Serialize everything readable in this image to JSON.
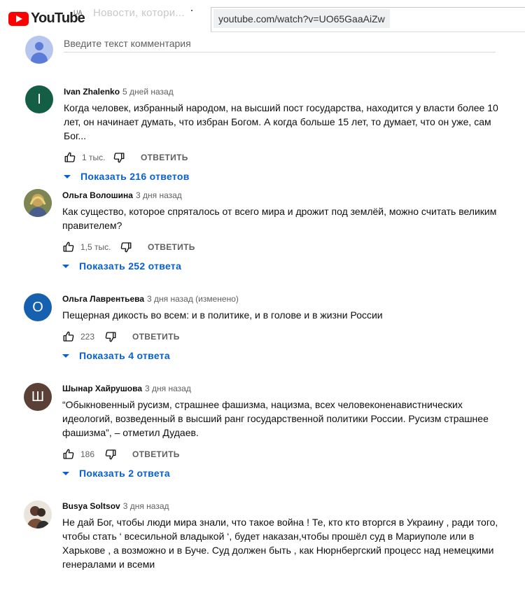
{
  "header": {
    "logo_text": "YouTube",
    "region": "UA",
    "ghost_title": "Новости, котори...",
    "url": "youtube.com/watch?v=UO65GaaAiZw"
  },
  "add_comment": {
    "placeholder": "Введите текст комментария"
  },
  "reply_label": "ОТВЕТИТЬ",
  "colors": {
    "link_blue": "#065fd4",
    "logo_red": "#ff0000",
    "muted": "#606060"
  },
  "comments": [
    {
      "author": "Ivan Zhalenko",
      "time": "5 дней назад",
      "avatar_letter": "I",
      "avatar_color": "#155e46",
      "text": "Когда человек, избранный народом, на высший пост государства, находится у власти более 10 лет, он начинает думать, что избран Богом. А когда больше 15 лет, то думает, что он уже, сам Бог...",
      "likes": "1 тыс.",
      "replies": "Показать 216 ответов"
    },
    {
      "author": "Ольга Волошина",
      "time": "3 дня назад",
      "avatar_letter": "",
      "avatar_color": "photo",
      "text": "Как существо, которое спряталось от всего мира и дрожит под землёй, можно считать великим правителем?",
      "likes": "1,5 тыс.",
      "replies": "Показать 252 ответа"
    },
    {
      "author": "Ольга Лаврентьева",
      "time": "3 дня назад (изменено)",
      "avatar_letter": "О",
      "avatar_color": "#1561b0",
      "text": "Пещерная дикость во всем: и в политике, и в голове и в жизни России",
      "likes": "223",
      "replies": "Показать 4 ответа"
    },
    {
      "author": "Шынар Хайрушова",
      "time": "3 дня назад",
      "avatar_letter": "Ш",
      "avatar_color": "#5a4036",
      "text": "“Обыкновенный русизм, страшнее фашизма, нацизма, всех человеконенавистнических идеологий, возведенный в высший ранг государственной политики России. Русизм страшнее фашизма”, – отметил Дудаев.",
      "likes": "186",
      "replies": "Показать 2 ответа"
    },
    {
      "author": "Busya Soltsov",
      "time": "3 дня назад",
      "avatar_letter": "",
      "avatar_color": "photo",
      "text": "Не дай Бог, чтобы люди мира знали, что такое война !  Те, кто кто вторгся в Украину , ради того, чтобы стать ‘ всесильной владыкой ‘, будет наказан,чтобы прошёл суд в Мариуполе или в Харькове , а возможно и в Буче.    Суд должен быть , как  Нюрнбергский процесс над немецкими генералами  и всеми"
    }
  ]
}
